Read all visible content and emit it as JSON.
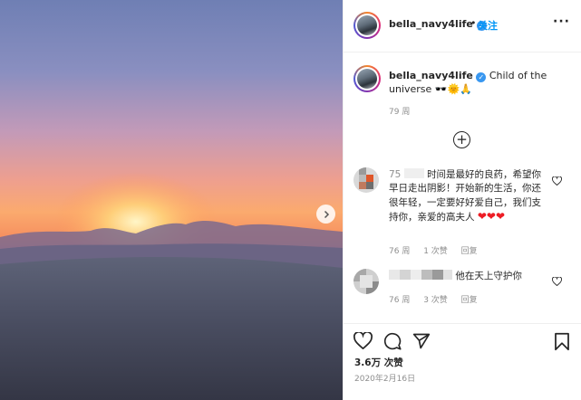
{
  "post": {
    "username": "bella_navy4life",
    "follow_label": "关注",
    "separator": "•",
    "more_label": "···",
    "caption": "Child of the universe",
    "caption_emoji": "🕶️🌞🙏",
    "caption_time": "79 周",
    "likes": "3.6万 次赞",
    "date": "2020年2月16日"
  },
  "comments": [
    {
      "prefix": "75",
      "text": "时间是最好的良药，希望你早日走出阴影！开始新的生活，你还很年轻，一定要好好爱自己，我们支持你，亲爱的高夫人",
      "time": "76 周",
      "likes": "1 次赞",
      "reply": "回复"
    },
    {
      "text": "他在天上守护你",
      "time": "76 周",
      "likes": "3 次赞",
      "reply": "回复"
    }
  ],
  "icons": {
    "verified": "verified-badge-icon",
    "load_more": "plus-circle-icon",
    "heart": "heart-icon",
    "comment": "comment-icon",
    "share": "send-icon",
    "save": "bookmark-icon",
    "next": "chevron-right-icon"
  },
  "colors": {
    "link": "#0095f6",
    "verified": "#3897f0",
    "heart": "#ed1c24",
    "muted": "#8e8e8e"
  }
}
